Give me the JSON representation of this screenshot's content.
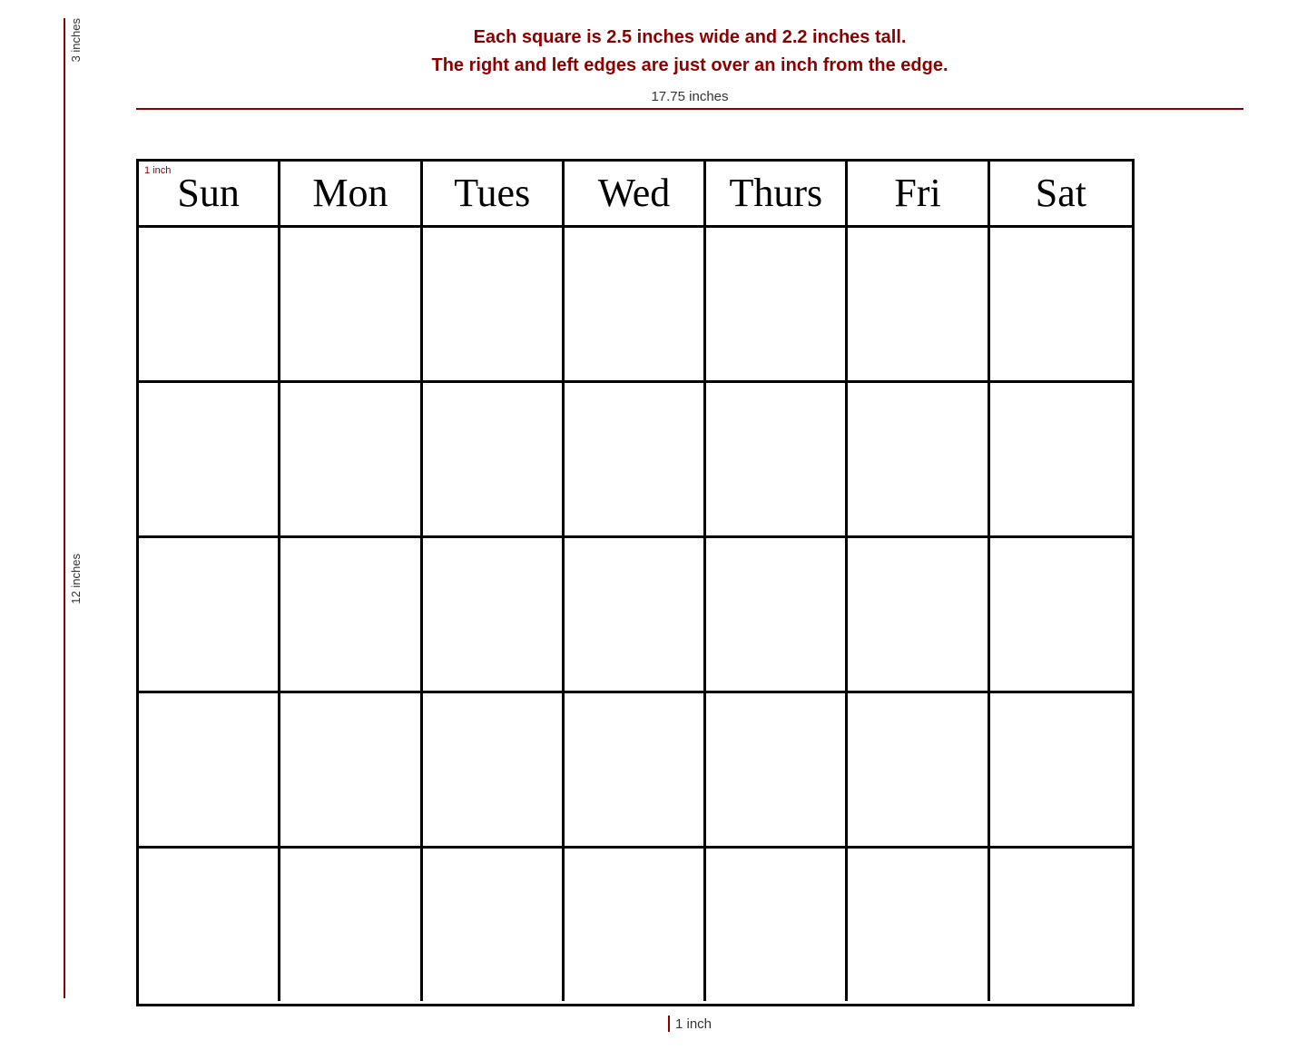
{
  "info": {
    "line1": "Each square is 2.5 inches wide and 2.2 inches tall.",
    "line2": "The right and left edges are just over an inch from the edge.",
    "width_label": "17.75 inches",
    "height_label_top": "3 inches",
    "height_label_main": "12 inches",
    "bottom_inch": "1 inch",
    "sun_inch": "1 inch"
  },
  "days": {
    "headers": [
      "Sun",
      "Mon",
      "Tues",
      "Wed",
      "Thurs",
      "Fri",
      "Sat"
    ]
  },
  "rows": 5
}
